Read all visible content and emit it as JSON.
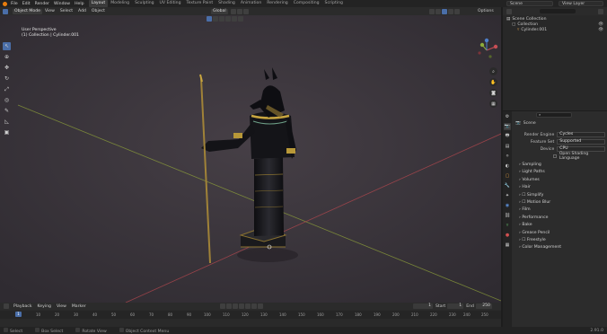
{
  "topbar": {
    "menus": [
      "File",
      "Edit",
      "Render",
      "Window",
      "Help"
    ],
    "workspaces": [
      "Layout",
      "Modeling",
      "Sculpting",
      "UV Editing",
      "Texture Paint",
      "Shading",
      "Animation",
      "Rendering",
      "Compositing",
      "Scripting"
    ],
    "active_workspace": "Layout",
    "scene": "Scene",
    "view_layer": "View Layer"
  },
  "viewport_header": {
    "mode": "Object Mode",
    "menus": [
      "View",
      "Select",
      "Add",
      "Object"
    ],
    "transform": "Global",
    "options": "Options"
  },
  "viewport": {
    "perspective_label": "User Perspective",
    "collection_label": "(1) Collection | Cylinder.001",
    "background": "#3e3940",
    "grid_x_color": "#b8484f",
    "grid_y_color": "#8ea13a"
  },
  "outliner": {
    "title": "Scene Collection",
    "items": [
      {
        "label": "Collection",
        "depth": 1
      },
      {
        "label": "Cylinder.001",
        "depth": 2
      }
    ]
  },
  "properties": {
    "title": "Scene",
    "fields": [
      {
        "label": "Render Engine",
        "value": "Cycles"
      },
      {
        "label": "Feature Set",
        "value": "Supported"
      },
      {
        "label": "Device",
        "value": "CPU"
      }
    ],
    "checkbox_label": "Open Shading Language",
    "panels": [
      "Sampling",
      "Light Paths",
      "Volumes",
      "Hair",
      "Simplify",
      "Motion Blur",
      "Film",
      "Performance",
      "Bake",
      "Grease Pencil",
      "Freestyle",
      "Color Management"
    ]
  },
  "timeline": {
    "menus": [
      "Playback",
      "Keying",
      "View",
      "Marker"
    ],
    "current_frame": "1",
    "start": "1",
    "end": "250",
    "start_label": "Start",
    "end_label": "End",
    "ruler": [
      "1",
      "10",
      "20",
      "30",
      "40",
      "50",
      "60",
      "70",
      "80",
      "90",
      "100",
      "110",
      "120",
      "130",
      "140",
      "150",
      "160",
      "170",
      "180",
      "190",
      "200",
      "210",
      "220",
      "230",
      "240",
      "250"
    ]
  },
  "statusbar": {
    "items": [
      "Select",
      "Box Select",
      "Rotate View",
      "Object Context Menu"
    ],
    "version": "2.91.0"
  }
}
